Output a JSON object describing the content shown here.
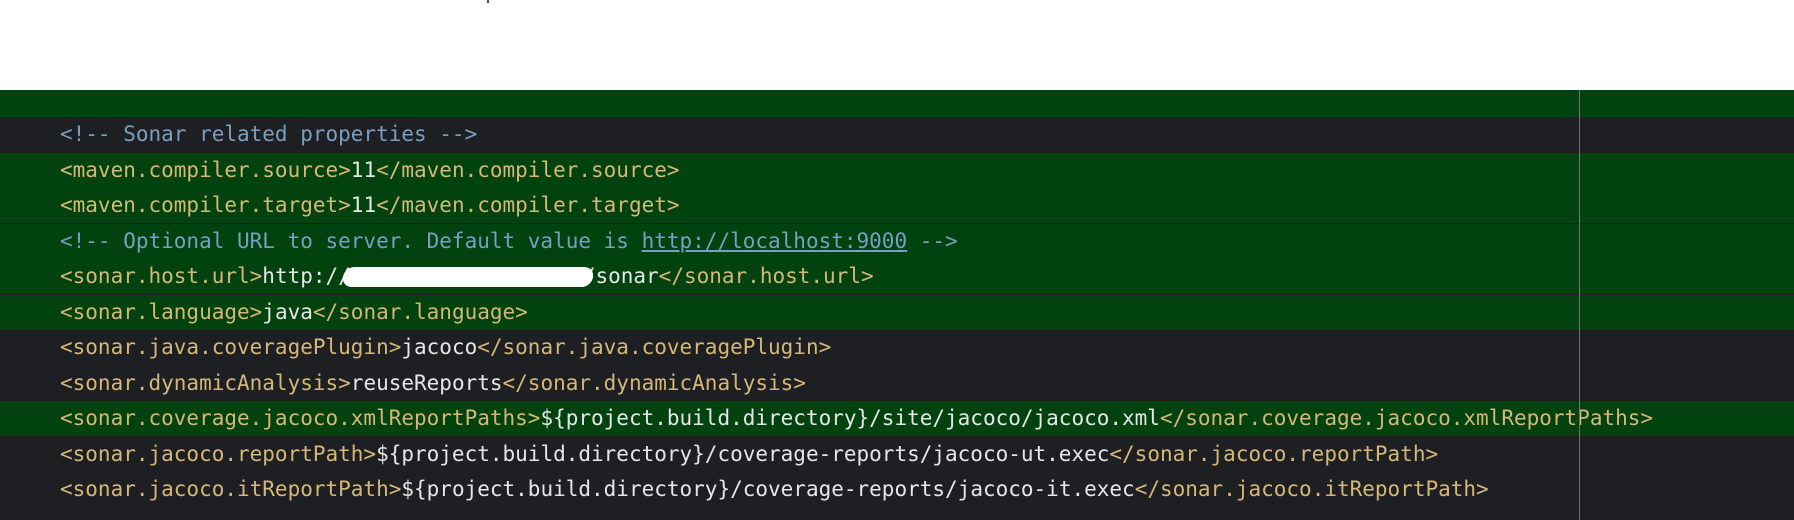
{
  "editor": {
    "lines": [
      {
        "changed": false,
        "parts": [
          {
            "cls": "cmt",
            "text": "<!-- Sonar related properties -->"
          }
        ]
      },
      {
        "changed": true,
        "parts": [
          {
            "cls": "tag",
            "text": "<maven.compiler.source>"
          },
          {
            "cls": "txt",
            "text": "11"
          },
          {
            "cls": "tag",
            "text": "</maven.compiler.source>"
          }
        ]
      },
      {
        "changed": true,
        "parts": [
          {
            "cls": "tag",
            "text": "<maven.compiler.target>"
          },
          {
            "cls": "txt",
            "text": "11"
          },
          {
            "cls": "tag",
            "text": "</maven.compiler.target>"
          }
        ]
      },
      {
        "changed": true,
        "parts": [
          {
            "cls": "cmt",
            "text": "<!-- Optional URL to server. Default value is "
          },
          {
            "cls": "lnk",
            "text": "http://localhost:9000"
          },
          {
            "cls": "cmt",
            "text": " -->"
          }
        ]
      },
      {
        "changed": true,
        "parts": [
          {
            "cls": "tag",
            "text": "<sonar.host.url>"
          },
          {
            "cls": "txt",
            "text": "http://"
          },
          {
            "cls": "redact",
            "text": ""
          },
          {
            "cls": "txt",
            "text": "/sonar"
          },
          {
            "cls": "tag",
            "text": "</sonar.host.url>"
          }
        ]
      },
      {
        "changed": true,
        "parts": [
          {
            "cls": "tag",
            "text": "<sonar.language>"
          },
          {
            "cls": "txt",
            "text": "java"
          },
          {
            "cls": "tag",
            "text": "</sonar.language>"
          }
        ]
      },
      {
        "changed": false,
        "parts": [
          {
            "cls": "tag",
            "text": "<sonar.java.coveragePlugin>"
          },
          {
            "cls": "txt",
            "text": "jacoco"
          },
          {
            "cls": "tag",
            "text": "</sonar.java.coveragePlugin>"
          }
        ]
      },
      {
        "changed": false,
        "parts": [
          {
            "cls": "tag",
            "text": "<sonar.dynamicAnalysis>"
          },
          {
            "cls": "txt",
            "text": "reuseReports"
          },
          {
            "cls": "tag",
            "text": "</sonar.dynamicAnalysis>"
          }
        ]
      },
      {
        "changed": true,
        "parts": [
          {
            "cls": "tag",
            "text": "<sonar.coverage.jacoco.xmlReportPaths>"
          },
          {
            "cls": "txt",
            "text": "${project.build.directory}/site/jacoco/jacoco.xml"
          },
          {
            "cls": "tag",
            "text": "</sonar.coverage.jacoco.xmlReportPaths>"
          }
        ]
      },
      {
        "changed": false,
        "parts": [
          {
            "cls": "tag",
            "text": "<sonar.jacoco.reportPath>"
          },
          {
            "cls": "txt",
            "text": "${project.build.directory}/coverage-reports/jacoco-ut.exec"
          },
          {
            "cls": "tag",
            "text": "</sonar.jacoco.reportPath>"
          }
        ]
      },
      {
        "changed": false,
        "parts": [
          {
            "cls": "tag",
            "text": "<sonar.jacoco.itReportPath>"
          },
          {
            "cls": "txt",
            "text": "${project.build.directory}/coverage-reports/jacoco-it.exec"
          },
          {
            "cls": "tag",
            "text": "</sonar.jacoco.itReportPath>"
          }
        ]
      }
    ]
  },
  "colors": {
    "editor_bg": "#1e1f22",
    "changed_line_bg": "#01420f",
    "tag": "#d5b778",
    "comment": "#7a9ec2",
    "text": "#e6e6e6"
  }
}
